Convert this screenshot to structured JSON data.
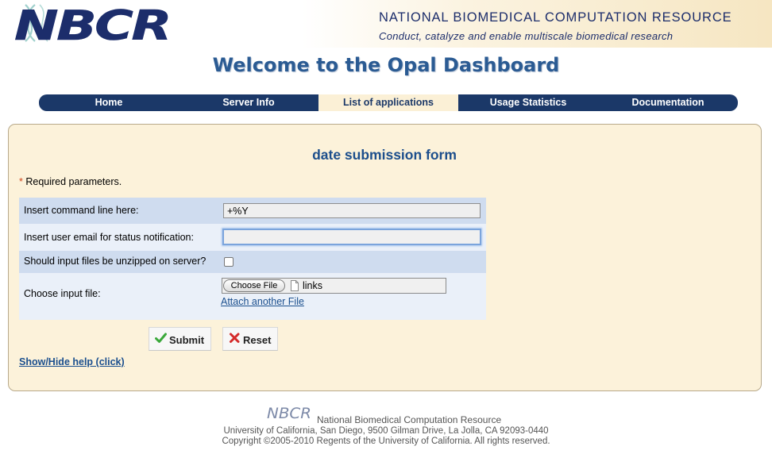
{
  "header": {
    "logo_text": "NBCR",
    "org_name": "NATIONAL BIOMEDICAL COMPUTATION RESOURCE",
    "tagline": "Conduct, catalyze and enable multiscale biomedical research"
  },
  "page_title": "Welcome to the Opal Dashboard",
  "nav": {
    "active": "List of applications",
    "items": [
      {
        "label": "Home"
      },
      {
        "label": "Server Info"
      },
      {
        "label": "List of applications"
      },
      {
        "label": "Usage Statistics"
      },
      {
        "label": "Documentation"
      }
    ]
  },
  "form": {
    "title": "date submission form",
    "required_star": "*",
    "required_note": " Required parameters.",
    "fields": {
      "command_line": {
        "label": "Insert command line here:",
        "value": "+%Y"
      },
      "email": {
        "label": "Insert user email for status notification:",
        "value": ""
      },
      "unzip": {
        "label": "Should input files be unzipped on server?",
        "checked": false
      },
      "input_file": {
        "label": "Choose input file:",
        "button_label": "Choose File",
        "file_name": "links",
        "attach_link": "Attach another File"
      }
    },
    "submit_label": "Submit",
    "reset_label": "Reset",
    "help_link": "Show/Hide help (click)"
  },
  "footer": {
    "logo_text": "NBCR",
    "org_name": "National Biomedical Computation Resource",
    "address": "University of California, San Diego, 9500 Gilman Drive, La Jolla, CA 92093-0440",
    "copyright": "Copyright ©2005-2010 Regents of the University of California. All rights reserved."
  },
  "colors": {
    "brand_navy": "#1c2d6b",
    "nav_bg": "#1b3868",
    "panel_bg": "#fcf2da",
    "row_dark": "#cfdcef",
    "row_light": "#eaf0f9",
    "link": "#1b4f8e",
    "required_star": "#d0451b"
  },
  "icons": {
    "submit": "checkmark-icon",
    "reset": "x-mark-icon",
    "file": "document-icon"
  }
}
